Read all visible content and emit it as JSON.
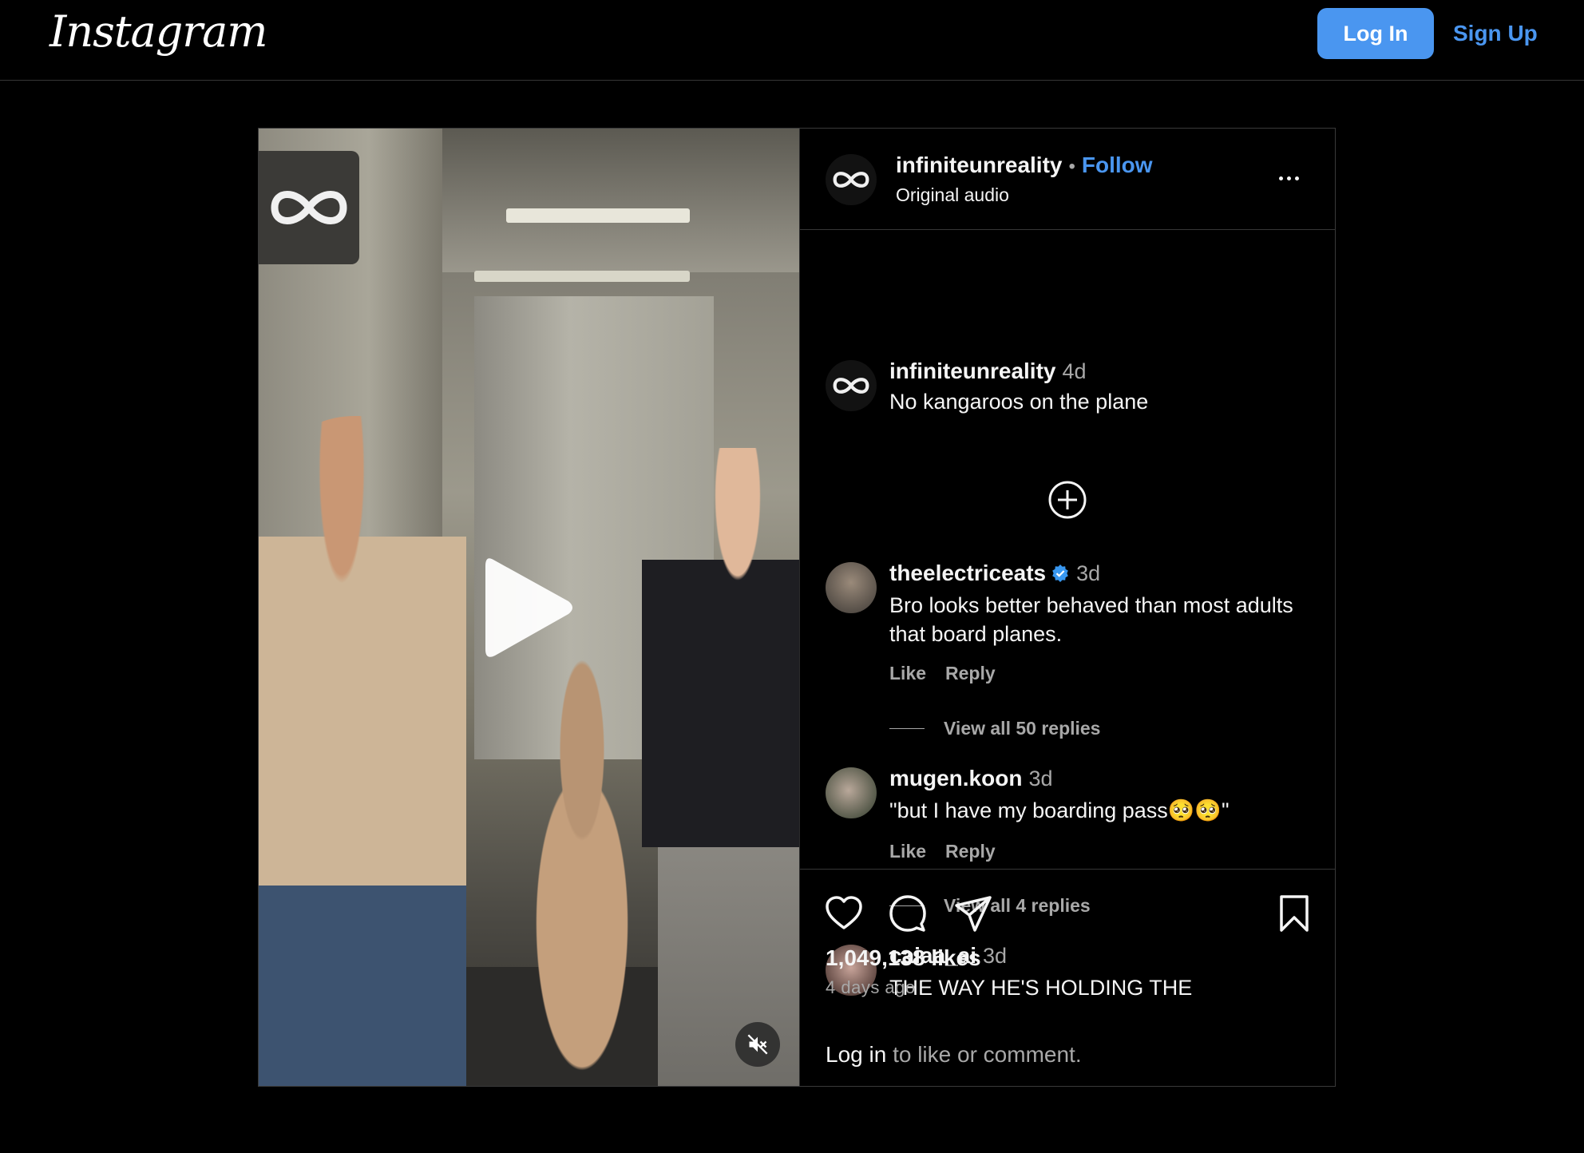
{
  "header": {
    "logo_text": "Instagram",
    "login_label": "Log In",
    "signup_label": "Sign Up"
  },
  "post": {
    "username": "infiniteunreality",
    "separator": "•",
    "follow_label": "Follow",
    "audio": "Original audio",
    "caption": {
      "username": "infiniteunreality",
      "time": "4d",
      "text": "No kangaroos on the plane"
    },
    "comments": [
      {
        "username": "theelectriceats",
        "verified": true,
        "time": "3d",
        "text": "Bro looks better behaved than most adults that board planes.",
        "like_label": "Like",
        "reply_label": "Reply",
        "view_replies": "View all 50 replies"
      },
      {
        "username": "mugen.koon",
        "verified": false,
        "time": "3d",
        "text": "\"but I have my boarding pass🥺🥺\"",
        "like_label": "Like",
        "reply_label": "Reply",
        "view_replies": "View all 4 replies"
      },
      {
        "username": "caiaa_ai",
        "verified": false,
        "time": "3d",
        "text": "THE WAY HE'S HOLDING THE"
      }
    ],
    "likes": "1,049,138 likes",
    "time_ago": "4 days ago",
    "login_prompt": {
      "link": "Log in",
      "rest": " to like or comment."
    }
  },
  "icons": {
    "play": "play-icon",
    "mute": "muted-speaker-icon",
    "more": "more-options-icon",
    "add_comment": "plus-circle-icon",
    "like": "heart-icon",
    "comment": "comment-bubble-icon",
    "share": "paper-plane-icon",
    "save": "bookmark-icon"
  },
  "colors": {
    "accent": "#4a96f0",
    "background": "#000000",
    "muted_text": "#a8a8a8",
    "border": "#363636",
    "verified": "#3897f0"
  }
}
